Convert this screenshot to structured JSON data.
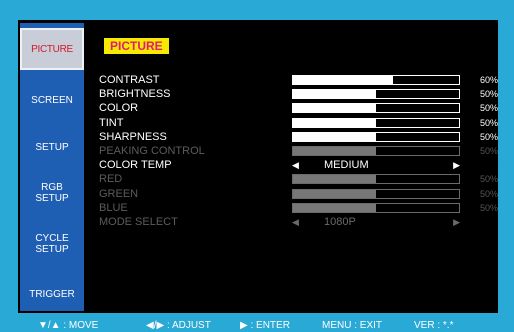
{
  "sidebar": {
    "tabs": [
      {
        "label": "PICTURE",
        "active": true
      },
      {
        "label": "SCREEN"
      },
      {
        "label": "SETUP"
      },
      {
        "label": "RGB SETUP"
      },
      {
        "label": "CYCLE SETUP"
      },
      {
        "label": "TRIGGER"
      }
    ]
  },
  "panel": {
    "title": "PICTURE",
    "rows": [
      {
        "label": "CONTRAST",
        "value": 60,
        "display": "60%",
        "enabled": true
      },
      {
        "label": "BRIGHTNESS",
        "value": 50,
        "display": "50%",
        "enabled": true
      },
      {
        "label": "COLOR",
        "value": 50,
        "display": "50%",
        "enabled": true
      },
      {
        "label": "TINT",
        "value": 50,
        "display": "50%",
        "enabled": true
      },
      {
        "label": "SHARPNESS",
        "value": 50,
        "display": "50%",
        "enabled": true
      },
      {
        "label": "PEAKING CONTROL",
        "value": 50,
        "display": "50%",
        "enabled": false
      },
      {
        "label": "COLOR TEMP",
        "select": "MEDIUM",
        "enabled": true
      },
      {
        "label": "RED",
        "value": 50,
        "display": "50%",
        "enabled": false
      },
      {
        "label": "GREEN",
        "value": 50,
        "display": "50%",
        "enabled": false
      },
      {
        "label": "BLUE",
        "value": 50,
        "display": "50%",
        "enabled": false
      },
      {
        "label": "MODE SELECT",
        "select": "1080P",
        "enabled": false
      }
    ]
  },
  "footer": {
    "move": "▼/▲ : MOVE",
    "adjust": "◀/▶ : ADJUST",
    "enter": "▶ : ENTER",
    "exit": "MENU : EXIT",
    "ver": "VER : *.*"
  },
  "arrows": {
    "left": "◀",
    "right": "▶"
  },
  "colors": {
    "background": "#29a9d6",
    "sidebar": "#1e5fb3",
    "header_bg": "#f6ea00",
    "header_text": "#e5197a",
    "active_tab_text": "#d21a2a"
  }
}
